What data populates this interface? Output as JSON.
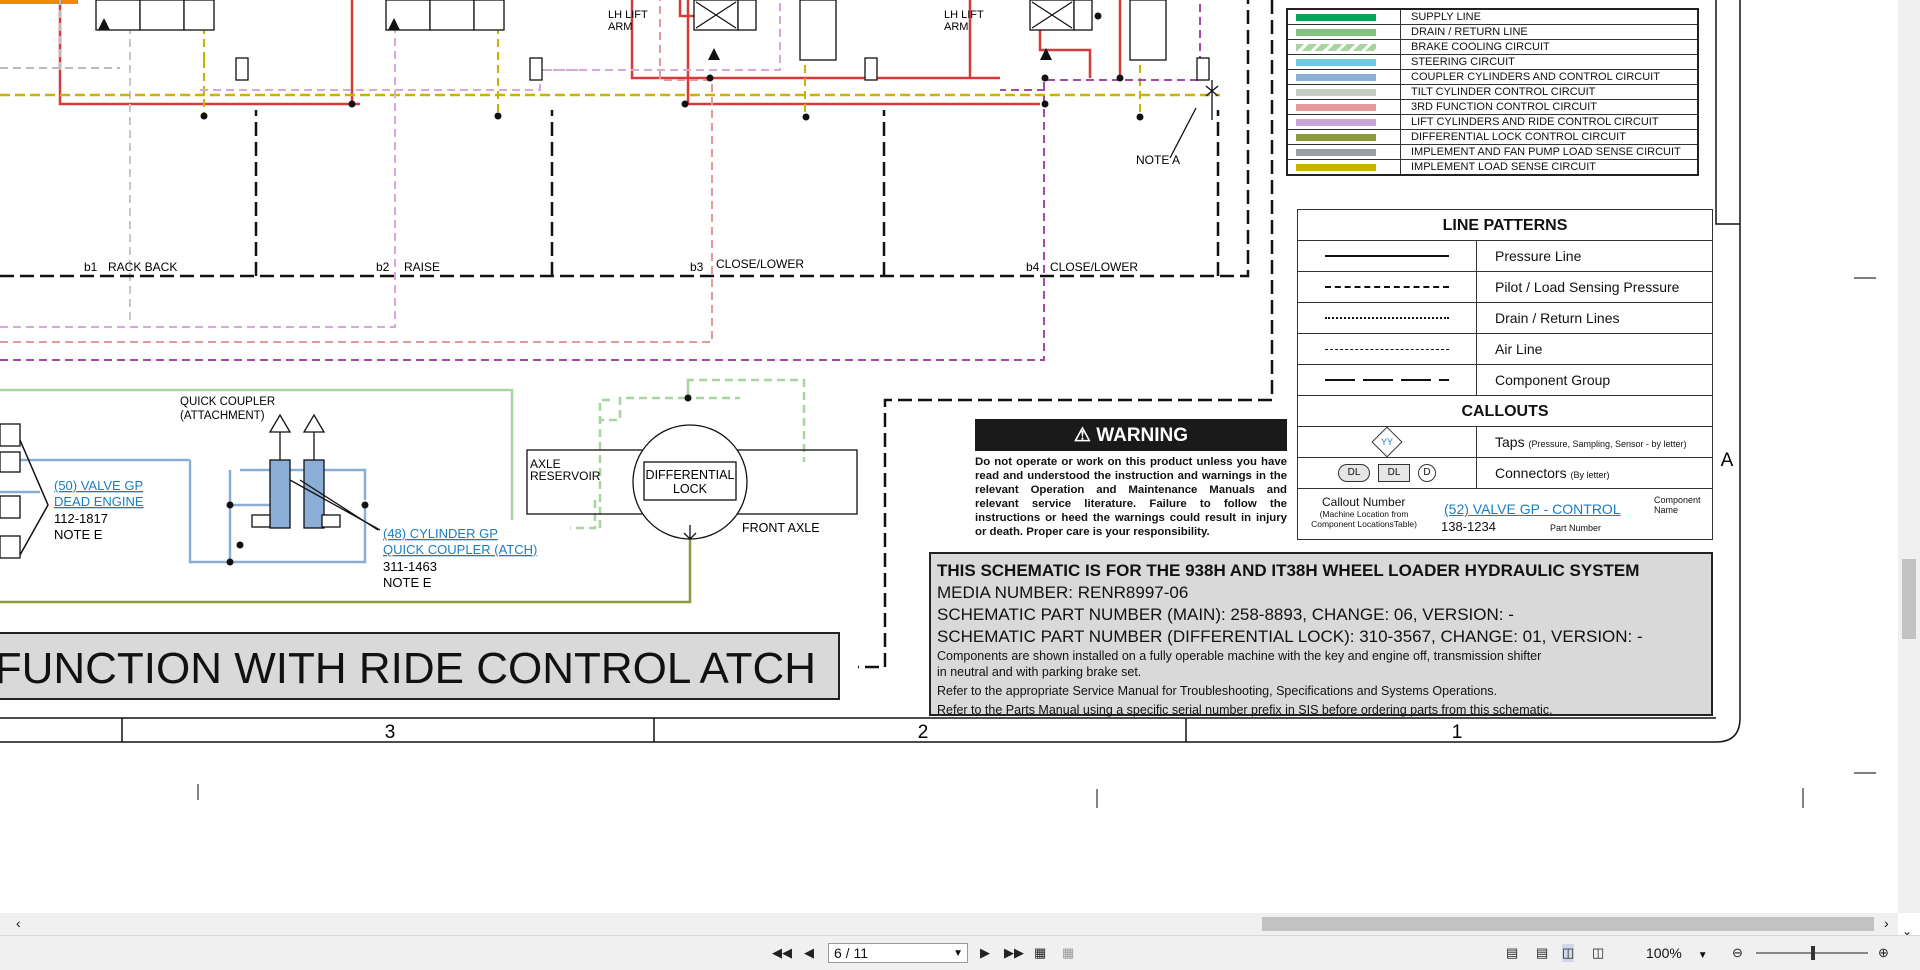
{
  "schematic": {
    "lift_arm_labels": [
      "LH LIFT\nARM",
      "LH LIFT\nARM"
    ],
    "section_labels": [
      {
        "id": "b1",
        "text": "RACK BACK"
      },
      {
        "id": "b2",
        "text": "RAISE"
      },
      {
        "id": "b3",
        "text": "CLOSE/LOWER"
      },
      {
        "id": "b4",
        "text": "CLOSE/LOWER"
      }
    ],
    "note_a": "NOTE A",
    "quick_coupler_label": "QUICK COUPLER\n(ATTACHMENT)",
    "valve_gp": {
      "link": "(50) VALVE GP\nDEAD ENGINE",
      "part": "112-1817",
      "note": "NOTE E"
    },
    "cylinder_gp": {
      "link": "(48) CYLINDER GP\nQUICK COUPLER (ATCH)",
      "part": "311-1463",
      "note": "NOTE E"
    },
    "axle_reservoir": "AXLE\nRESERVOIR",
    "differential_lock": "DIFFERENTIAL\nLOCK",
    "front_axle": "FRONT AXLE",
    "banner": "FUNCTION WITH RIDE CONTROL ATCH",
    "grid_numbers": [
      "3",
      "2",
      "1"
    ],
    "grid_letter": "A"
  },
  "legend": [
    {
      "color": "#12a05a",
      "label": "SUPPLY LINE"
    },
    {
      "color": "#7fc47f",
      "label": "DRAIN / RETURN LINE"
    },
    {
      "color": "#a8d4a0",
      "label": "BRAKE COOLING CIRCUIT"
    },
    {
      "color": "#6fc9e0",
      "label": "STEERING CIRCUIT"
    },
    {
      "color": "#8aaed6",
      "label": "COUPLER CYLINDERS AND CONTROL CIRCUIT"
    },
    {
      "color": "#c4cdc4",
      "label": "TILT CYLINDER CONTROL CIRCUIT"
    },
    {
      "color": "#e49a9a",
      "label": "3RD FUNCTION CONTROL CIRCUIT"
    },
    {
      "color": "#caa6d8",
      "label": "LIFT CYLINDERS AND RIDE CONTROL CIRCUIT"
    },
    {
      "color": "#8b9a3c",
      "label": "DIFFERENTIAL LOCK CONTROL CIRCUIT"
    },
    {
      "color": "#99a0a6",
      "label": "IMPLEMENT AND FAN PUMP LOAD SENSE CIRCUIT"
    },
    {
      "color": "#c8b400",
      "label": "IMPLEMENT LOAD SENSE CIRCUIT"
    }
  ],
  "line_patterns": {
    "title": "LINE PATTERNS",
    "rows": [
      {
        "style": "solid",
        "label": "Pressure Line"
      },
      {
        "style": "dashed",
        "label": "Pilot / Load Sensing Pressure"
      },
      {
        "style": "dotted",
        "label": "Drain / Return Lines"
      },
      {
        "style": "thin-dashed",
        "label": "Air Line"
      },
      {
        "style": "dash-long",
        "label": "Component Group"
      }
    ]
  },
  "callouts": {
    "title": "CALLOUTS",
    "taps_symbol": "YY",
    "taps_label": "Taps",
    "taps_note": "(Pressure, Sampling, Sensor - by letter)",
    "connector_symbols": [
      "DL",
      "DL",
      "D"
    ],
    "connectors_label": "Connectors",
    "connectors_note": "(By letter)",
    "callout_number": "Callout Number",
    "callout_number_note": "(Machine Location from\nComponent LocationsTable)",
    "example_link": "(52) VALVE GP - CONTROL",
    "component_name": "Component\nName",
    "example_part": "138-1234",
    "part_number_label": "Part Number"
  },
  "warning": {
    "title": "WARNING",
    "body": "Do not operate or work on this product unless you have read and understood the instruction and warnings in the relevant Operation and Maintenance Manuals and relevant service literature. Failure to follow the instructions or heed the warnings could result in injury or death. Proper care is your responsibility."
  },
  "info": {
    "title": "THIS SCHEMATIC IS FOR THE 938H AND IT38H WHEEL LOADER HYDRAULIC SYSTEM",
    "media": "MEDIA NUMBER: RENR8997-06",
    "part_main": "SCHEMATIC PART NUMBER (MAIN): 258-8893, CHANGE: 06, VERSION: -",
    "part_diff": "SCHEMATIC PART NUMBER (DIFFERENTIAL LOCK): 310-3567, CHANGE: 01, VERSION: -",
    "note1": "Components are shown installed on a fully operable machine with the key and engine off, transmission shifter",
    "note1b": "in neutral and with parking brake set.",
    "note2": "Refer to the appropriate Service Manual for Troubleshooting, Specifications and Systems Operations.",
    "note3": "Refer to the Parts Manual using a specific serial number prefix in SIS before ordering parts from this schematic."
  },
  "toolbar": {
    "page_display": "6 / 11",
    "zoom": "100%"
  },
  "icons": [
    "first-page-icon",
    "prev-page-icon",
    "next-page-icon",
    "last-page-icon",
    "zoom-out-icon",
    "zoom-in-icon"
  ]
}
